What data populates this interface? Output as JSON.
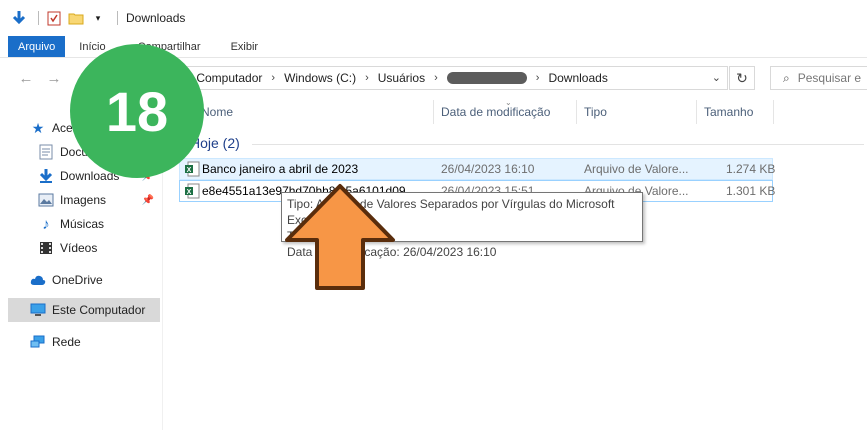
{
  "titlebar": {
    "title": "Downloads",
    "quick_access": [
      "down-arrow-icon",
      "properties-checkmark-icon",
      "folder-icon",
      "customize-dropdown-icon"
    ]
  },
  "ribbon": {
    "tabs": [
      "Arquivo",
      "Início",
      "Compartilhar",
      "Exibir"
    ]
  },
  "address": {
    "crumbs": [
      "Este Computador",
      "Windows (C:)",
      "Usuários",
      "",
      "Downloads"
    ],
    "redacted_segment": true
  },
  "search": {
    "placeholder": "Pesquisar e"
  },
  "nav": {
    "items": [
      {
        "label": "Acesso rápido",
        "icon": "star-icon"
      },
      {
        "label": "Documentos",
        "icon": "document-icon"
      },
      {
        "label": "Downloads",
        "icon": "download-icon"
      },
      {
        "label": "Imagens",
        "icon": "pictures-icon"
      },
      {
        "label": "Músicas",
        "icon": "music-icon"
      },
      {
        "label": "Vídeos",
        "icon": "video-icon"
      },
      {
        "label": "OneDrive",
        "icon": "cloud-icon"
      },
      {
        "label": "Este Computador",
        "icon": "computer-icon"
      },
      {
        "label": "Rede",
        "icon": "network-icon"
      }
    ]
  },
  "columns": [
    "Nome",
    "Data de modificação",
    "Tipo",
    "Tamanho"
  ],
  "group": {
    "label": "Hoje (2)"
  },
  "files": [
    {
      "name": "Banco janeiro a abril de 2023",
      "modified": "26/04/2023 16:10",
      "type": "Arquivo de Valore...",
      "size": "1.274 KB"
    },
    {
      "name": "e8e4551a13e97hd70hh8...5a6101d09",
      "modified": "26/04/2023 15:51",
      "type": "Arquivo de Valore...",
      "size": "1.301 KB"
    }
  ],
  "tooltip": {
    "line1": "Tipo: Arquivo de Valores Separados por Vírgulas do Microsoft Excel",
    "line2": "Tamanho: 1,24 MB",
    "line3": "Data de modificação: 26/04/2023 16:10"
  },
  "overlay": {
    "step_number": "18",
    "badge_color": "#3cb55c",
    "arrow_color": "#f79646"
  }
}
